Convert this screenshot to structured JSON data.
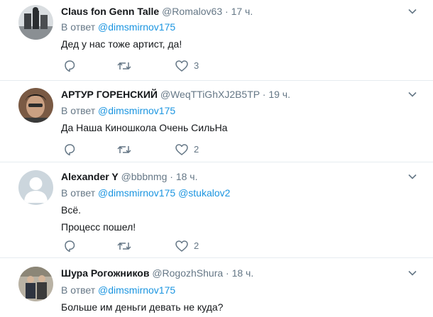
{
  "reply_prefix": "В ответ",
  "tweets": [
    {
      "name": "Claus fon Genn Talle",
      "handle": "@Romalov63",
      "time": "17 ч.",
      "mentions": [
        "@dimsmirnov175"
      ],
      "lines": [
        "Дед у нас тоже артист, да!"
      ],
      "likes": "3",
      "avatar": "photo"
    },
    {
      "name": "АРТУР ГОРЕНСКИЙ",
      "handle": "@WeqTTiGhXJ2B5TP",
      "time": "19 ч.",
      "mentions": [
        "@dimsmirnov175"
      ],
      "lines": [
        "Да Наша Киношкола Очень СильНа"
      ],
      "likes": "2",
      "avatar": "photo"
    },
    {
      "name": "Alexander Y",
      "handle": "@bbbnmg",
      "time": "18 ч.",
      "mentions": [
        "@dimsmirnov175",
        "@stukalov2"
      ],
      "lines": [
        "Всё.",
        "Процесс пошел!"
      ],
      "likes": "2",
      "avatar": "default"
    },
    {
      "name": "Шура Рогожников",
      "handle": "@RogozhShura",
      "time": "18 ч.",
      "mentions": [
        "@dimsmirnov175"
      ],
      "lines": [
        "Больше им деньги девать не куда?"
      ],
      "avatar": "photo"
    }
  ],
  "colors": {
    "text": "#14171a",
    "secondary": "#657786",
    "link": "#1b95e0",
    "divider": "#e6ecf0"
  },
  "icons": [
    "reply-icon",
    "retweet-icon",
    "like-icon",
    "chevron-down-icon"
  ]
}
